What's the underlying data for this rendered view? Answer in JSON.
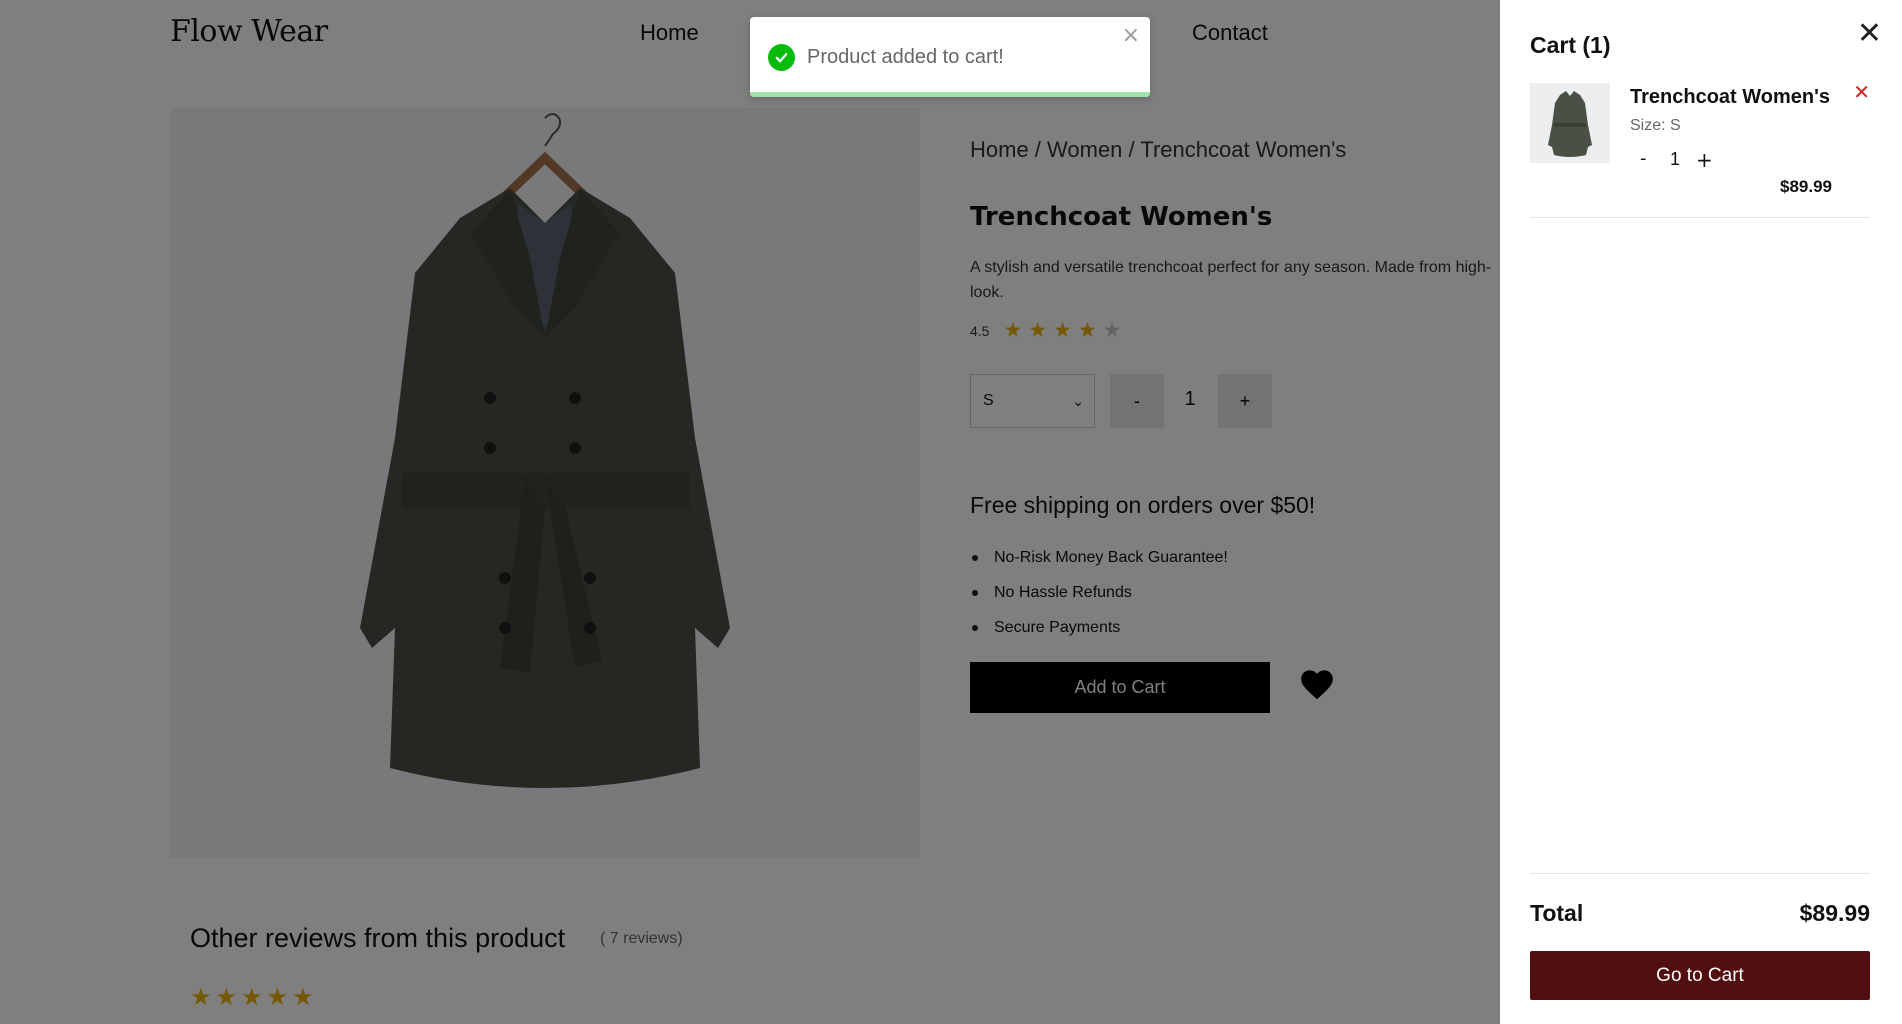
{
  "header": {
    "logo": "Flow Wear",
    "nav": [
      "Home",
      "Contact"
    ]
  },
  "product": {
    "breadcrumb": "Home / Women / Trenchcoat Women's",
    "title": "Trenchcoat Women's",
    "description": "A stylish and versatile trenchcoat perfect for any season. Made from high-",
    "description_cont": "look.",
    "rating": "4.5",
    "rating_value": 4.5,
    "rating_max": 5,
    "size_selected": "S",
    "qty_minus": "-",
    "quantity": "1",
    "qty_plus": "+",
    "shipping_headline": "Free shipping on orders over $50!",
    "features": [
      "No-Risk Money Back Guarantee!",
      "No Hassle Refunds",
      "Secure Payments"
    ],
    "add_to_cart_label": "Add to Cart",
    "reviews_title": "Other reviews from this product",
    "reviews_count": "( 7 reviews)",
    "review_rating": 5
  },
  "toast": {
    "message": "Product added to cart!",
    "close_glyph": "×",
    "progress": 1.0
  },
  "cart": {
    "title": "Cart (1)",
    "close_glyph": "✕",
    "item": {
      "name": "Trenchcoat Women's",
      "size": "Size: S",
      "minus": "-",
      "qty": "1",
      "plus": "+",
      "price": "$89.99",
      "remove_glyph": "✕"
    },
    "total_label": "Total",
    "total_value": "$89.99",
    "go_to_cart_label": "Go to Cart"
  },
  "colors": {
    "star_on": "#e9b10a",
    "star_off": "#c7c7c7",
    "toast_success": "#07bc0c",
    "go_to_cart_bg": "#520f10",
    "remove_red": "#d62020"
  },
  "icons": {
    "select_chevron": "chevron-down-icon",
    "wishlist": "heart-icon",
    "toast_status": "check-circle-icon"
  }
}
